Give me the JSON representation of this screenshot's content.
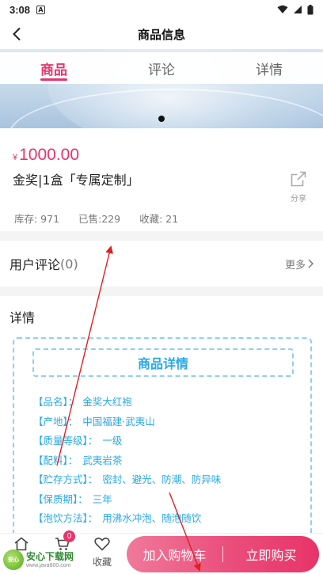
{
  "status_bar": {
    "time": "3:08",
    "notif_glyph": "A"
  },
  "header": {
    "title": "商品信息"
  },
  "tabs": [
    {
      "label": "商品",
      "active": true
    },
    {
      "label": "评论",
      "active": false
    },
    {
      "label": "详情",
      "active": false
    }
  ],
  "banner": {
    "slide_count": 1,
    "active_slide": 1
  },
  "product": {
    "currency": "¥",
    "price": "1000.00",
    "name": "金奖|1盒「专属定制」",
    "share_label": "分享",
    "stock": "库存: 971",
    "sold": "已售:229",
    "favorites": "收藏: 21"
  },
  "reviews": {
    "label": "用户评论",
    "count": "(0)",
    "more": "更多"
  },
  "details": {
    "heading": "详情",
    "box_title": "商品详情",
    "attributes": [
      {
        "key": "【品名】：",
        "value": "金奖大红袍"
      },
      {
        "key": "【产地】：",
        "value": "中国福建·武夷山"
      },
      {
        "key": "【质量等级】：",
        "value": "一级"
      },
      {
        "key": "【配料】：",
        "value": "武夷岩茶"
      },
      {
        "key": "【贮存方式】：",
        "value": "密封、避光、防潮、防异味"
      },
      {
        "key": "【保质期】：",
        "value": "三年"
      },
      {
        "key": "【泡饮方法】：",
        "value": "用沸水冲泡、随泡随饮"
      }
    ]
  },
  "bottom_bar": {
    "cart_badge": "0",
    "favorite_label": "收藏",
    "add_to_cart": "加入购物车",
    "buy_now": "立即购买"
  },
  "watermark": {
    "logo_text": "安心",
    "name": "安心下载网",
    "url": "www.java800.com"
  },
  "colors": {
    "accent": "#e9336a",
    "detail_blue": "#29a9e6",
    "dashed_border": "#8fd0f2"
  }
}
